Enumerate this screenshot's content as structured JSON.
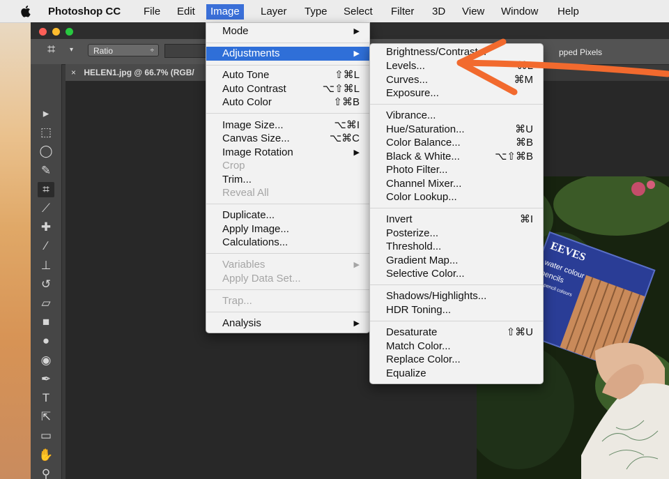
{
  "menubar": {
    "app_name": "Photoshop CC",
    "items": [
      "File",
      "Edit",
      "Image",
      "Layer",
      "Type",
      "Select",
      "Filter",
      "3D",
      "View",
      "Window",
      "Help"
    ],
    "active": "Image"
  },
  "options_bar": {
    "ratio_label": "Ratio",
    "crop_option": "pped Pixels"
  },
  "document": {
    "tab_title": "HELEN1.jpg @ 66.7% (RGB/"
  },
  "image_menu": {
    "items": [
      {
        "label": "Mode",
        "shortcut": "",
        "submenu": true,
        "disabled": false,
        "highlighted": false
      },
      {
        "label": "Adjustments",
        "shortcut": "",
        "submenu": true,
        "disabled": false,
        "highlighted": true
      },
      {
        "label": "Auto Tone",
        "shortcut": "⇧⌘L",
        "submenu": false,
        "disabled": false,
        "highlighted": false
      },
      {
        "label": "Auto Contrast",
        "shortcut": "⌥⇧⌘L",
        "submenu": false,
        "disabled": false,
        "highlighted": false
      },
      {
        "label": "Auto Color",
        "shortcut": "⇧⌘B",
        "submenu": false,
        "disabled": false,
        "highlighted": false
      },
      {
        "label": "Image Size...",
        "shortcut": "⌥⌘I",
        "submenu": false,
        "disabled": false,
        "highlighted": false
      },
      {
        "label": "Canvas Size...",
        "shortcut": "⌥⌘C",
        "submenu": false,
        "disabled": false,
        "highlighted": false
      },
      {
        "label": "Image Rotation",
        "shortcut": "",
        "submenu": true,
        "disabled": false,
        "highlighted": false
      },
      {
        "label": "Crop",
        "shortcut": "",
        "submenu": false,
        "disabled": true,
        "highlighted": false
      },
      {
        "label": "Trim...",
        "shortcut": "",
        "submenu": false,
        "disabled": false,
        "highlighted": false
      },
      {
        "label": "Reveal All",
        "shortcut": "",
        "submenu": false,
        "disabled": true,
        "highlighted": false
      },
      {
        "label": "Duplicate...",
        "shortcut": "",
        "submenu": false,
        "disabled": false,
        "highlighted": false
      },
      {
        "label": "Apply Image...",
        "shortcut": "",
        "submenu": false,
        "disabled": false,
        "highlighted": false
      },
      {
        "label": "Calculations...",
        "shortcut": "",
        "submenu": false,
        "disabled": false,
        "highlighted": false
      },
      {
        "label": "Variables",
        "shortcut": "",
        "submenu": true,
        "disabled": true,
        "highlighted": false
      },
      {
        "label": "Apply Data Set...",
        "shortcut": "",
        "submenu": false,
        "disabled": true,
        "highlighted": false
      },
      {
        "label": "Trap...",
        "shortcut": "",
        "submenu": false,
        "disabled": true,
        "highlighted": false
      },
      {
        "label": "Analysis",
        "shortcut": "",
        "submenu": true,
        "disabled": false,
        "highlighted": false
      }
    ]
  },
  "adjustments_menu": {
    "items": [
      {
        "label": "Brightness/Contrast...",
        "shortcut": ""
      },
      {
        "label": "Levels...",
        "shortcut": "⌘L"
      },
      {
        "label": "Curves...",
        "shortcut": "⌘M"
      },
      {
        "label": "Exposure...",
        "shortcut": ""
      },
      {
        "label": "Vibrance...",
        "shortcut": ""
      },
      {
        "label": "Hue/Saturation...",
        "shortcut": "⌘U"
      },
      {
        "label": "Color Balance...",
        "shortcut": "⌘B"
      },
      {
        "label": "Black & White...",
        "shortcut": "⌥⇧⌘B"
      },
      {
        "label": "Photo Filter...",
        "shortcut": ""
      },
      {
        "label": "Channel Mixer...",
        "shortcut": ""
      },
      {
        "label": "Color Lookup...",
        "shortcut": ""
      },
      {
        "label": "Invert",
        "shortcut": "⌘I"
      },
      {
        "label": "Posterize...",
        "shortcut": ""
      },
      {
        "label": "Threshold...",
        "shortcut": ""
      },
      {
        "label": "Gradient Map...",
        "shortcut": ""
      },
      {
        "label": "Selective Color...",
        "shortcut": ""
      },
      {
        "label": "Shadows/Highlights...",
        "shortcut": ""
      },
      {
        "label": "HDR Toning...",
        "shortcut": ""
      },
      {
        "label": "Desaturate",
        "shortcut": "⇧⌘U"
      },
      {
        "label": "Match Color...",
        "shortcut": ""
      },
      {
        "label": "Replace Color...",
        "shortcut": ""
      },
      {
        "label": "Equalize",
        "shortcut": ""
      }
    ]
  },
  "photo": {
    "box_text_brand": "EEVES",
    "box_text_line1": "water colour",
    "box_text_line2": "pencils",
    "box_text_line3": "12 pencil colours"
  },
  "tools": [
    "move-tool-icon",
    "marquee-tool-icon",
    "lasso-tool-icon",
    "quick-select-tool-icon",
    "crop-tool-icon",
    "eyedropper-tool-icon",
    "healing-brush-tool-icon",
    "brush-tool-icon",
    "clone-stamp-tool-icon",
    "history-brush-tool-icon",
    "eraser-tool-icon",
    "gradient-tool-icon",
    "blur-tool-icon",
    "dodge-tool-icon",
    "pen-tool-icon",
    "type-tool-icon",
    "path-select-tool-icon",
    "shape-tool-icon",
    "hand-tool-icon",
    "zoom-tool-icon",
    "swap-colors-icon"
  ],
  "colors": {
    "menu_highlight": "#2f6fd8",
    "annotation_arrow": "#f26a2e"
  }
}
